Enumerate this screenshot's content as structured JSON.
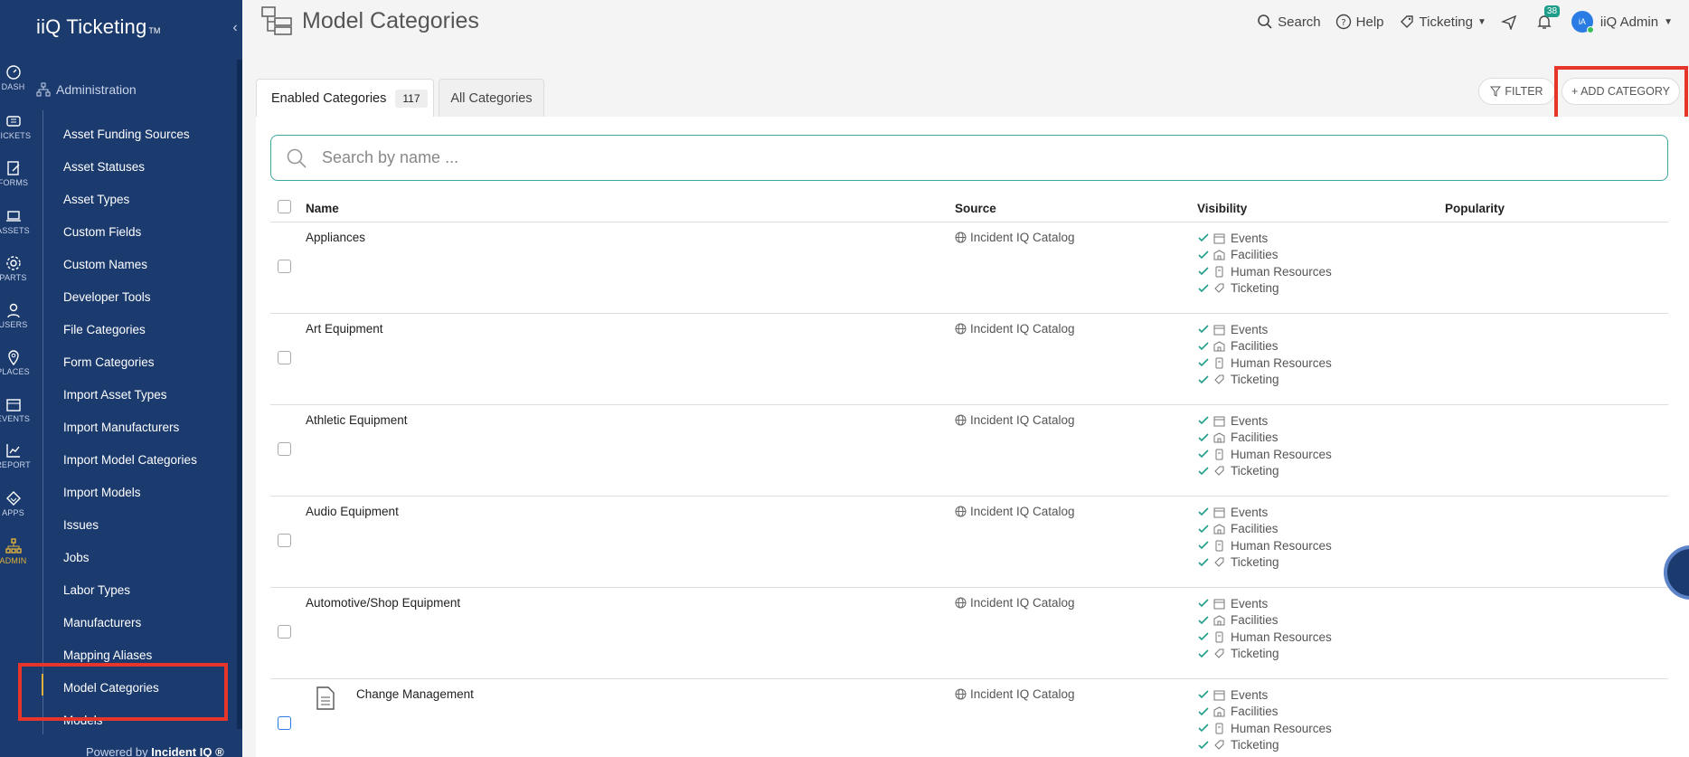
{
  "brand": {
    "name": "iiQ Ticketing",
    "tm": "TM"
  },
  "rail": [
    {
      "label": "DASH",
      "icon": "dashboard-icon"
    },
    {
      "label": "TICKETS",
      "icon": "ticket-icon"
    },
    {
      "label": "FORMS",
      "icon": "form-icon"
    },
    {
      "label": "ASSETS",
      "icon": "laptop-icon"
    },
    {
      "label": "PARTS",
      "icon": "gear-icon"
    },
    {
      "label": "USERS",
      "icon": "user-icon"
    },
    {
      "label": "PLACES",
      "icon": "pin-icon"
    },
    {
      "label": "EVENTS",
      "icon": "calendar-icon"
    },
    {
      "label": "REPORT",
      "icon": "chart-icon"
    },
    {
      "label": "APPS",
      "icon": "apps-icon"
    },
    {
      "label": "ADMIN",
      "icon": "org-chart-icon"
    }
  ],
  "sidebar": {
    "section": "Administration",
    "items": [
      "Asset Funding Sources",
      "Asset Statuses",
      "Asset Types",
      "Custom Fields",
      "Custom Names",
      "Developer Tools",
      "File Categories",
      "Form Categories",
      "Import Asset Types",
      "Import Manufacturers",
      "Import Model Categories",
      "Import Models",
      "Issues",
      "Jobs",
      "Labor Types",
      "Manufacturers",
      "Mapping Aliases",
      "Model Categories",
      "Models"
    ],
    "powered_prefix": "Powered by",
    "powered_brand": "Incident IQ ®"
  },
  "header": {
    "title": "Model Categories",
    "search_label": "Search",
    "help_label": "Help",
    "ticketing_label": "Ticketing",
    "notifications_count": "38",
    "avatar_initials": "iA",
    "user_name": "iiQ Admin"
  },
  "tabs": {
    "enabled_label": "Enabled Categories",
    "enabled_count": "117",
    "all_label": "All Categories"
  },
  "toolbar": {
    "filter_label": "FILTER",
    "add_label": "+ ADD CATEGORY"
  },
  "search": {
    "placeholder": "Search by name ..."
  },
  "table": {
    "columns": {
      "name": "Name",
      "source": "Source",
      "visibility": "Visibility",
      "popularity": "Popularity"
    },
    "visibility_labels": [
      "Events",
      "Facilities",
      "Human Resources",
      "Ticketing"
    ],
    "rows": [
      {
        "name": "Appliances",
        "source": "Incident IQ Catalog"
      },
      {
        "name": "Art Equipment",
        "source": "Incident IQ Catalog"
      },
      {
        "name": "Athletic Equipment",
        "source": "Incident IQ Catalog"
      },
      {
        "name": "Audio Equipment",
        "source": "Incident IQ Catalog"
      },
      {
        "name": "Automotive/Shop Equipment",
        "source": "Incident IQ Catalog"
      },
      {
        "name": "Change Management",
        "source": "Incident IQ Catalog"
      }
    ]
  },
  "colors": {
    "sidebar": "#1b3a6e",
    "accent": "#1e9e8a",
    "highlight": "#e6362b",
    "active": "#e0b23a"
  }
}
